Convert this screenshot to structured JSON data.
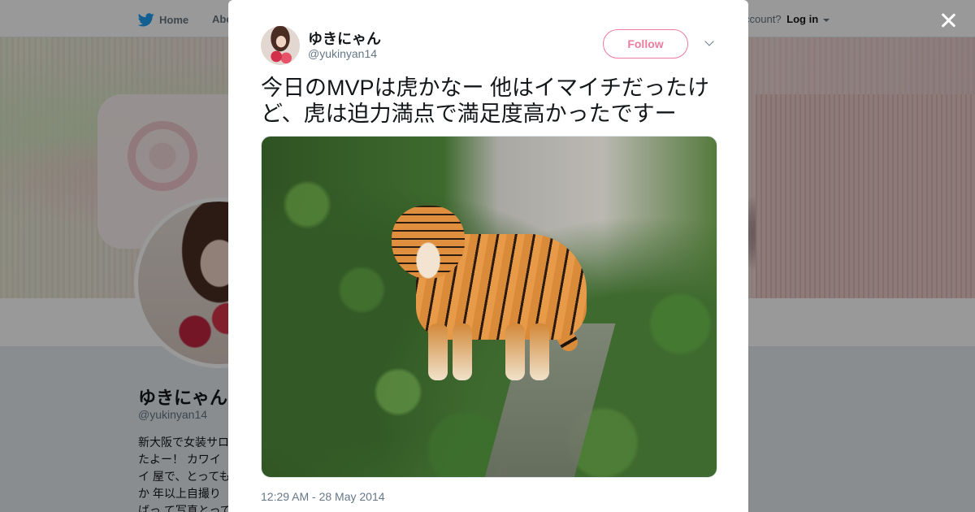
{
  "nav": {
    "home_label": "Home",
    "about_label": "Abo",
    "account_prompt": "ccount?",
    "login_label": "Log in"
  },
  "profile": {
    "name": "ゆきにゃん",
    "handle": "@yukinyan14",
    "bio": "新大阪で女装サロ たよー！ カワイイ 屋で、とってもか 年以上自撮りばっ て写真とってるよ"
  },
  "tweet": {
    "author_name": "ゆきにゃん",
    "author_handle": "@yukinyan14",
    "follow_label": "Follow",
    "text": "今日のMVPは虎かなー 他はイマイチだったけど、虎は迫力満点で満足度高かったですー",
    "timestamp": "12:29 AM - 28 May 2014"
  },
  "colors": {
    "brand_blue": "#1da1f2",
    "follow_pink": "#e0245e",
    "text_dark": "#14171a",
    "text_muted": "#657786"
  },
  "icons": {
    "brand": "bird-icon",
    "close": "close-icon",
    "menu": "chevron-down-icon"
  }
}
